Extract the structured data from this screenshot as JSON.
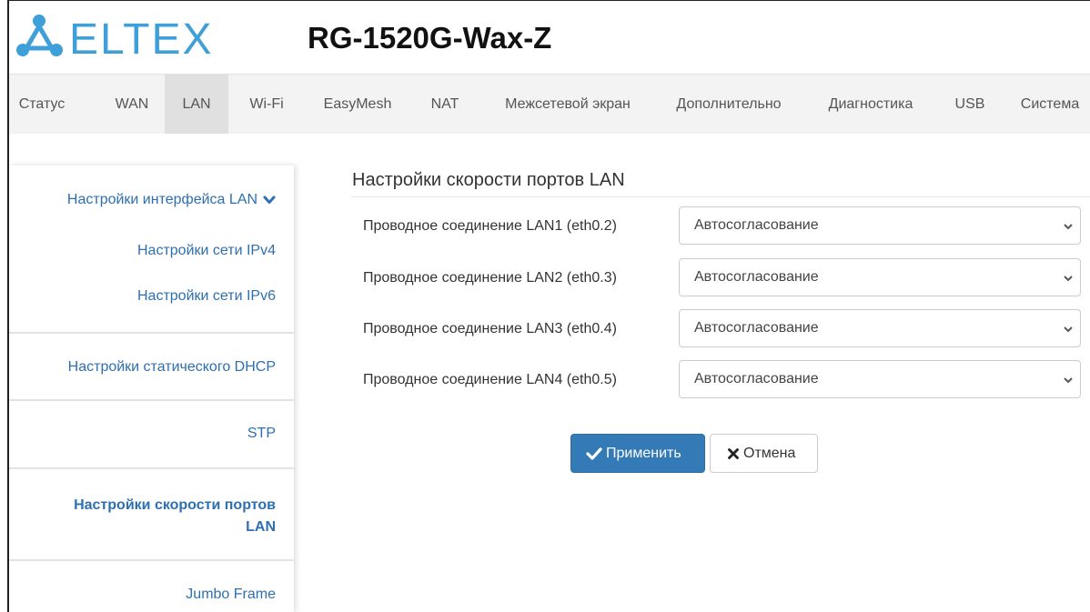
{
  "header": {
    "brand": "ELTEX",
    "model": "RG-1520G-Wax-Z",
    "brand_color": "#3f9fd8"
  },
  "nav": {
    "items": [
      {
        "label": "Статус"
      },
      {
        "label": "WAN"
      },
      {
        "label": "LAN",
        "active": true
      },
      {
        "label": "Wi-Fi"
      },
      {
        "label": "EasyMesh"
      },
      {
        "label": "NAT"
      },
      {
        "label": "Межсетевой экран"
      },
      {
        "label": "Дополнительно"
      },
      {
        "label": "Диагностика"
      },
      {
        "label": "USB"
      },
      {
        "label": "Система"
      }
    ]
  },
  "sidebar": {
    "items": [
      {
        "label": "Настройки интерфейса LAN",
        "icon": "chevron-down-icon"
      },
      {
        "label": "Настройки сети IPv4"
      },
      {
        "label": "Настройки сети IPv6"
      },
      {
        "label": "Настройки статического DHCP"
      },
      {
        "label": "STP"
      },
      {
        "label_line1": "Настройки скорости портов",
        "label_line2": "LAN",
        "active": true
      },
      {
        "label": "Jumbo Frame"
      }
    ]
  },
  "main": {
    "title": "Настройки скорости портов LAN",
    "rows": [
      {
        "label": "Проводное соединение LAN1 (eth0.2)",
        "value": "Автосогласование"
      },
      {
        "label": "Проводное соединение LAN2 (eth0.3)",
        "value": "Автосогласование"
      },
      {
        "label": "Проводное соединение LAN3 (eth0.4)",
        "value": "Автосогласование"
      },
      {
        "label": "Проводное соединение LAN4 (eth0.5)",
        "value": "Автосогласование"
      }
    ],
    "apply_label": "Применить",
    "cancel_label": "Отмена",
    "accent_color": "#337ab7",
    "link_color": "#2e6fb0"
  }
}
